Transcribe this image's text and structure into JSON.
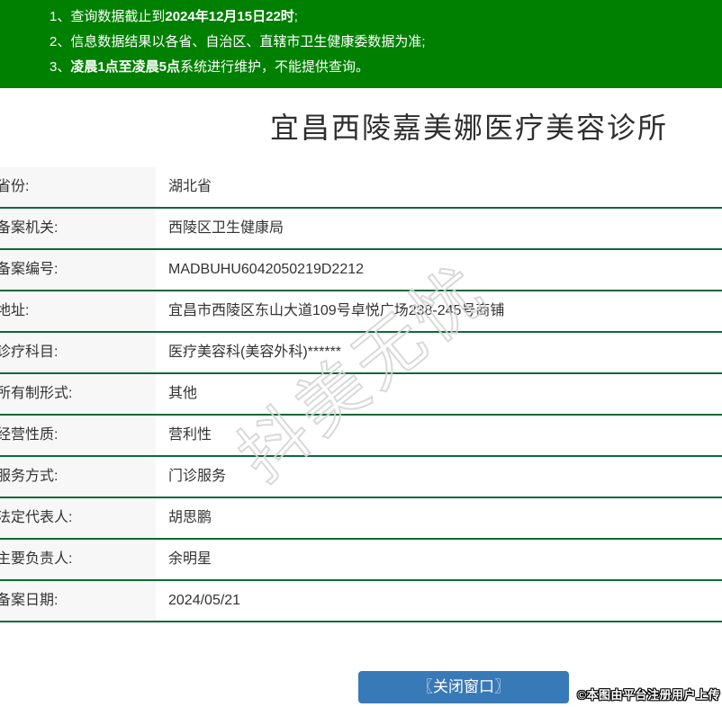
{
  "page": {
    "title": "宜昌西陵嘉美娜医疗美容诊所"
  },
  "notices": [
    {
      "num": "1、",
      "pre": "查询数据截止到",
      "bold": "2024年12月15日22时",
      "suf": ";"
    },
    {
      "num": "2、",
      "pre": "信息数据结果以各省、自治区、直辖市卫生健康委数据为准;",
      "bold": "",
      "suf": ""
    },
    {
      "num": "3、",
      "pre": "",
      "bold": "凌晨1点至凌晨5点",
      "suf": "系统进行维护，不能提供查询。"
    }
  ],
  "table": {
    "rows": [
      {
        "label": "省份:",
        "value": "湖北省"
      },
      {
        "label": "备案机关:",
        "value": "西陵区卫生健康局"
      },
      {
        "label": "备案编号:",
        "value": "MADBUHU6042050219D2212"
      },
      {
        "label": "地址:",
        "value": "宜昌市西陵区东山大道109号卓悦广场238-245号商铺"
      },
      {
        "label": "诊疗科目:",
        "value": "医疗美容科(美容外科)******"
      },
      {
        "label": "所有制形式:",
        "value": "其他"
      },
      {
        "label": "经营性质:",
        "value": "营利性"
      },
      {
        "label": "服务方式:",
        "value": "门诊服务"
      },
      {
        "label": "法定代表人:",
        "value": "胡思鹏"
      },
      {
        "label": "主要负责人:",
        "value": "余明星"
      },
      {
        "label": "备案日期:",
        "value": "2024/05/21"
      }
    ]
  },
  "watermark": {
    "text": "抖美无忧"
  },
  "footer": {
    "close_button_label": "〖关闭窗口〗",
    "credit": "©本图由平台注册用户上传"
  },
  "colors": {
    "header_green": "#008000",
    "divider_green": "#0e6839",
    "button_blue": "#3879b7",
    "label_bg": "#f7f7f7"
  }
}
